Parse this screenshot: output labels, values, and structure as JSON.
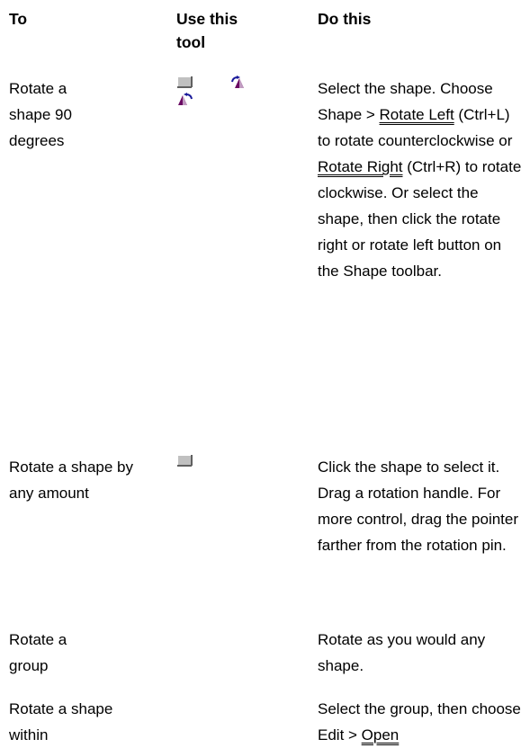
{
  "header": {
    "col1": "To",
    "col2": "Use this tool",
    "col3": "Do this"
  },
  "rows": [
    {
      "to": "Rotate a shape 90 degrees",
      "tool_icons": [
        "pointer-tool-icon",
        "rotate-right-icon",
        "rotate-left-icon"
      ],
      "do_parts": [
        "Select the shape. Choose Shape > ",
        "Rotate Left",
        " (Ctrl+L) to rotate counterclockwise or ",
        "Rotate Right",
        " (Ctrl+R) to rotate clockwise. Or select the shape, then click the rotate right or rotate left button on the Shape toolbar."
      ]
    },
    {
      "to": "Rotate a shape by any amount",
      "tool_icons": [
        "pointer-tool-icon"
      ],
      "do": "Click the shape to select it. Drag a rotation handle. For more control, drag the pointer farther from the rotation pin."
    },
    {
      "to": "Rotate a group",
      "tool_icons": [],
      "do": "Rotate as you would any shape."
    },
    {
      "to": "Rotate a shape within",
      "tool_icons": [],
      "do_parts": [
        "Select the group, then choose Edit > ",
        "Open "
      ]
    }
  ]
}
